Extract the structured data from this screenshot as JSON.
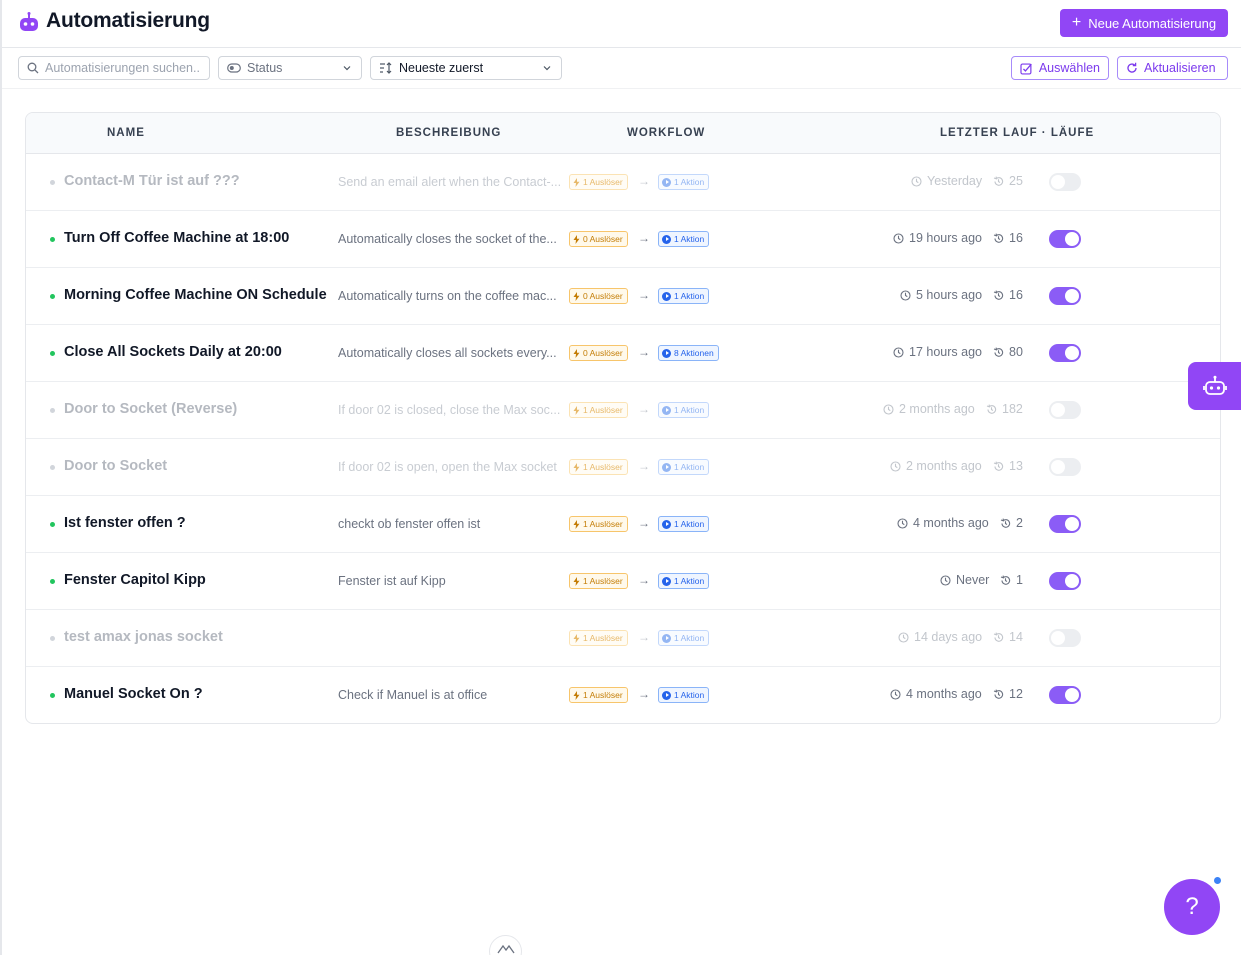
{
  "header": {
    "title": "Automatisierung",
    "new_button": "Neue Automatisierung"
  },
  "toolbar": {
    "search_placeholder": "Automatisierungen suchen..",
    "status_select": "Status",
    "sort_select": "Neueste zuerst",
    "select_button": "Auswählen",
    "refresh_button": "Aktualisieren"
  },
  "table": {
    "headers": {
      "name": "NAME",
      "description": "BESCHREIBUNG",
      "workflow": "WORKFLOW",
      "last_run": "LETZTER LAUF · LÄUFE"
    },
    "rows": [
      {
        "name": "Contact-M Tür ist auf ???",
        "description": "Send an email alert when the Contact-...",
        "trigger": "1 Auslöser",
        "action": "1 Aktion",
        "last_run": "Yesterday",
        "runs": "25",
        "enabled": false
      },
      {
        "name": "Turn Off Coffee Machine at 18:00",
        "description": "Automatically closes the socket of the...",
        "trigger": "0 Auslöser",
        "action": "1 Aktion",
        "last_run": "19 hours ago",
        "runs": "16",
        "enabled": true
      },
      {
        "name": "Morning Coffee Machine ON Schedule",
        "description": "Automatically turns on the coffee mac...",
        "trigger": "0 Auslöser",
        "action": "1 Aktion",
        "last_run": "5 hours ago",
        "runs": "16",
        "enabled": true
      },
      {
        "name": "Close All Sockets Daily at 20:00",
        "description": "Automatically closes all sockets every...",
        "trigger": "0 Auslöser",
        "action": "8 Aktionen",
        "last_run": "17 hours ago",
        "runs": "80",
        "enabled": true
      },
      {
        "name": "Door to Socket (Reverse)",
        "description": "If door 02 is closed, close the Max soc...",
        "trigger": "1 Auslöser",
        "action": "1 Aktion",
        "last_run": "2 months ago",
        "runs": "182",
        "enabled": false
      },
      {
        "name": "Door to Socket",
        "description": "If door 02 is open, open the Max socket",
        "trigger": "1 Auslöser",
        "action": "1 Aktion",
        "last_run": "2 months ago",
        "runs": "13",
        "enabled": false
      },
      {
        "name": "Ist fenster offen ?",
        "description": "checkt ob fenster offen ist",
        "trigger": "1 Auslöser",
        "action": "1 Aktion",
        "last_run": "4 months ago",
        "runs": "2",
        "enabled": true
      },
      {
        "name": "Fenster Capitol Kipp",
        "description": "Fenster ist auf Kipp",
        "trigger": "1 Auslöser",
        "action": "1 Aktion",
        "last_run": "Never",
        "runs": "1",
        "enabled": true
      },
      {
        "name": "test amax jonas socket",
        "description": "",
        "trigger": "1 Auslöser",
        "action": "1 Aktion",
        "last_run": "14 days ago",
        "runs": "14",
        "enabled": false
      },
      {
        "name": "Manuel Socket On ?",
        "description": "Check if Manuel is at office",
        "trigger": "1 Auslöser",
        "action": "1 Aktion",
        "last_run": "4 months ago",
        "runs": "12",
        "enabled": true
      }
    ]
  },
  "help": {
    "label": "?"
  },
  "icons": {
    "header": "robot-icon",
    "search": "search-icon",
    "status": "toggle-icon",
    "sort": "sort-icon",
    "select": "checkbox-edit-icon",
    "refresh": "refresh-icon",
    "trigger": "lightning-icon",
    "action": "play-icon",
    "last_run": "clock-icon",
    "runs": "history-icon",
    "side_tab": "robot-icon"
  },
  "colors": {
    "accent": "#9146f5",
    "active_dot": "#22c55e",
    "trigger_badge": "#c47d06",
    "action_badge": "#2563eb",
    "help_dot": "#3b82f6"
  }
}
